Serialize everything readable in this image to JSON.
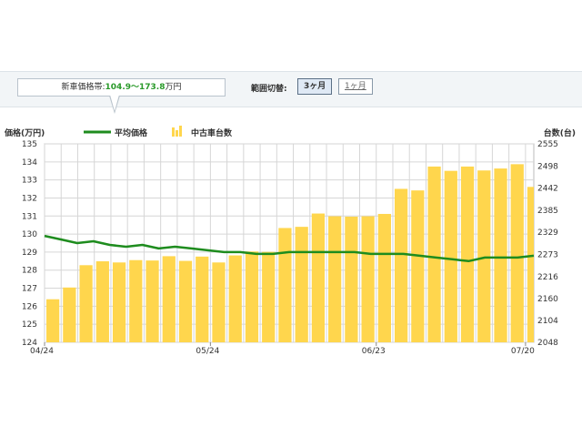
{
  "header": {
    "price_prefix": "新車価格帯:",
    "price_low": "104.9",
    "price_sep": "～",
    "price_high": "173.8",
    "price_unit": "万円",
    "range_label": "範囲切替:",
    "range_buttons": [
      {
        "label": "3ヶ月",
        "active": true
      },
      {
        "label": "1ヶ月",
        "active": false
      }
    ]
  },
  "colors": {
    "line": "#1e8c1e",
    "bar": "#ffd64d",
    "grid": "#d6d6d6"
  },
  "chart_data": {
    "type": "bar",
    "ylabel": "価格(万円)",
    "y2label": "台数(台)",
    "legend": [
      {
        "name": "平均価格",
        "kind": "line"
      },
      {
        "name": "中古車台数",
        "kind": "bar"
      }
    ],
    "ylim": [
      124,
      135
    ],
    "y_ticks": [
      "124",
      "125",
      "126",
      "127",
      "128",
      "129",
      "130",
      "131",
      "132",
      "133",
      "134",
      "135"
    ],
    "y2lim": [
      2048,
      2555
    ],
    "y2_ticks": [
      "2048",
      "2104",
      "2160",
      "2216",
      "2273",
      "2329",
      "2385",
      "2442",
      "2498",
      "2555"
    ],
    "x_tick_labels": [
      {
        "index": 0,
        "label": "04/24"
      },
      {
        "index": 10,
        "label": "05/24"
      },
      {
        "index": 20,
        "label": "06/23"
      },
      {
        "index": 29,
        "label": "07/20"
      }
    ],
    "x_count": 30,
    "series": [
      {
        "name": "中古車台数",
        "kind": "bar",
        "axis": "right",
        "values": [
          2158,
          2188,
          2245,
          2255,
          2252,
          2258,
          2257,
          2268,
          2256,
          2267,
          2252,
          2270,
          2280,
          2279,
          2340,
          2343,
          2377,
          2370,
          2369,
          2370,
          2376,
          2440,
          2436,
          2497,
          2486,
          2497,
          2487,
          2492,
          2503,
          2445
        ]
      },
      {
        "name": "平均価格",
        "kind": "line",
        "axis": "left",
        "values": [
          129.9,
          129.7,
          129.5,
          129.6,
          129.4,
          129.3,
          129.4,
          129.2,
          129.3,
          129.2,
          129.1,
          129.0,
          129.0,
          128.9,
          128.9,
          129.0,
          129.0,
          129.0,
          129.0,
          129.0,
          128.9,
          128.9,
          128.9,
          128.8,
          128.7,
          128.6,
          128.5,
          128.7,
          128.7,
          128.7,
          128.8
        ]
      }
    ]
  }
}
